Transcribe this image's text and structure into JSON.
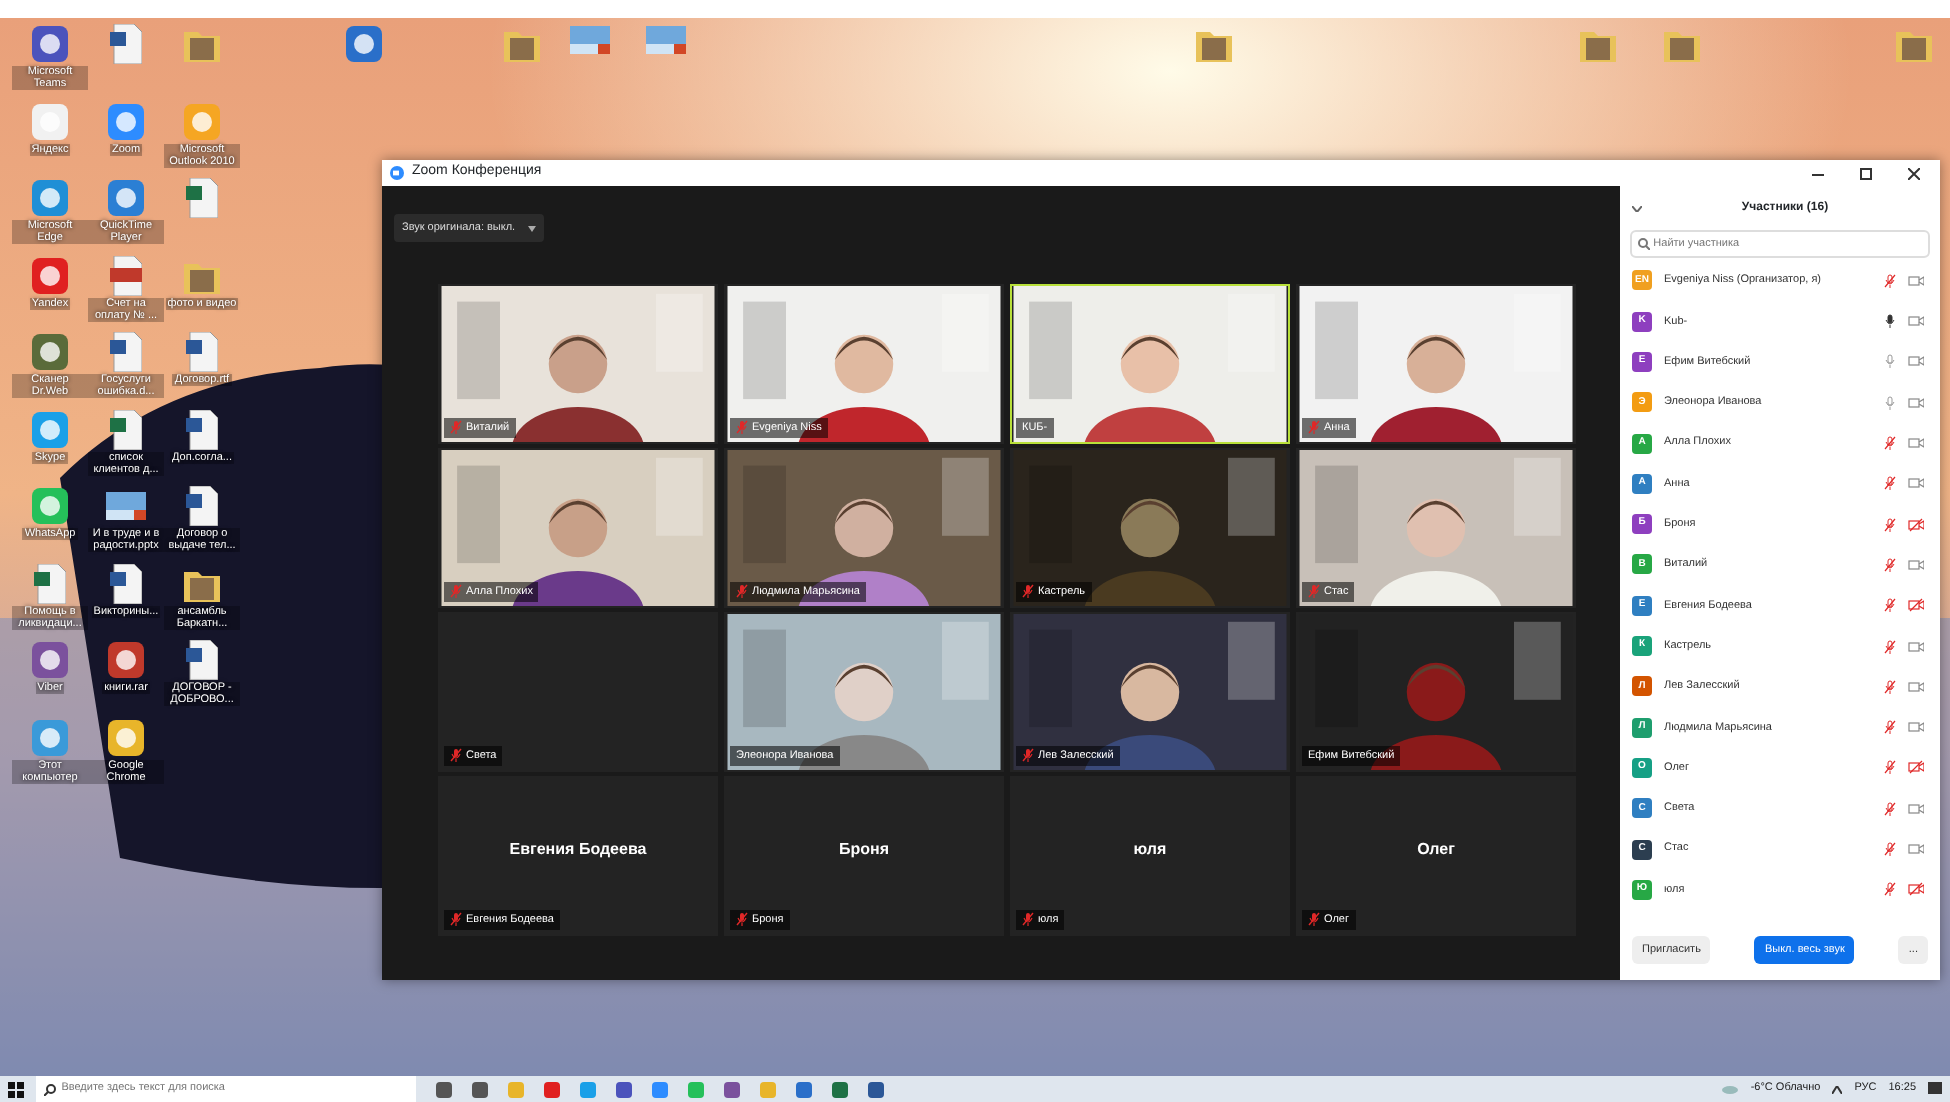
{
  "desktop_icons": [
    {
      "kind": "app",
      "color": "#4b53bc",
      "label": "Microsoft Teams"
    },
    {
      "kind": "doc"
    },
    {
      "kind": "folder"
    },
    {
      "kind": "app",
      "color": "#f1f1f1",
      "label": "Яндекс"
    },
    {
      "kind": "app",
      "color": "#2d8cff",
      "label": "Zoom"
    },
    {
      "kind": "app",
      "color": "#f5a623",
      "label": "Microsoft Outlook 2010"
    },
    {
      "kind": "app",
      "color": "#1f8fd6",
      "label": "Microsoft Edge"
    },
    {
      "kind": "app",
      "color": "#2b7fd4",
      "label": "QuickTime Player"
    },
    {
      "kind": "sheet"
    },
    {
      "kind": "app",
      "color": "#e02020",
      "label": "Yandex"
    },
    {
      "kind": "pdf",
      "label": "Счет на оплату № ..."
    },
    {
      "kind": "folder",
      "label": "фото и видео"
    },
    {
      "kind": "app",
      "color": "#5a6b3a",
      "label": "Сканер Dr.Web"
    },
    {
      "kind": "doc",
      "label": "Госуслуги ошибка.d..."
    },
    {
      "kind": "doc",
      "label": "Договор.rtf"
    },
    {
      "kind": "app",
      "color": "#1aa0e8",
      "label": "Skype"
    },
    {
      "kind": "sheet",
      "label": "список клиентов д..."
    },
    {
      "kind": "doc",
      "label": "Доп.согла..."
    },
    {
      "kind": "app",
      "color": "#25c05a",
      "label": "WhatsApp"
    },
    {
      "kind": "slide",
      "label": "И в труде и в радости.pptx"
    },
    {
      "kind": "doc",
      "label": "Договор о выдаче тел..."
    },
    {
      "kind": "sheet",
      "label": "Помощь в ликвидаци..."
    },
    {
      "kind": "doc",
      "label": "Викторины..."
    },
    {
      "kind": "folder",
      "label": "ансамбль Баркатн..."
    },
    {
      "kind": "app",
      "color": "#7b519d",
      "label": "Viber"
    },
    {
      "kind": "app",
      "color": "#c0392b",
      "label": "книги.rar"
    },
    {
      "kind": "doc",
      "label": "ДОГОВОР - ДОБРОВО..."
    },
    {
      "kind": "app",
      "color": "#3a9ad9",
      "label": "Этот компьютер"
    },
    {
      "kind": "app",
      "color": "#e8b52a",
      "label": "Google Chrome"
    }
  ],
  "window": {
    "title": "Zoom Конференция",
    "audio_dropdown": "Звук оригинала: выкл."
  },
  "tiles": [
    {
      "kind": "video",
      "name": "Виталий",
      "muted": true,
      "speaking": false
    },
    {
      "kind": "video",
      "name": "Evgeniya Niss",
      "muted": true,
      "speaking": false
    },
    {
      "kind": "video",
      "name": "КUБ-",
      "muted": false,
      "speaking": true
    },
    {
      "kind": "video",
      "name": "Анна",
      "muted": true,
      "speaking": false
    },
    {
      "kind": "video",
      "name": "Алла Плохих",
      "muted": true,
      "speaking": false
    },
    {
      "kind": "video",
      "name": "Людмила Марьясина",
      "muted": true,
      "speaking": false
    },
    {
      "kind": "video",
      "name": "Кастрель",
      "muted": true,
      "speaking": false
    },
    {
      "kind": "video",
      "name": "Стас",
      "muted": true,
      "speaking": false
    },
    {
      "kind": "blank",
      "name": "Света",
      "muted": true,
      "speaking": false
    },
    {
      "kind": "video",
      "name": "Элеонора Иванова",
      "muted": false,
      "speaking": false
    },
    {
      "kind": "video",
      "name": "Лев Залесский",
      "muted": true,
      "speaking": false
    },
    {
      "kind": "video",
      "name": "Ефим Витебский",
      "muted": false,
      "speaking": false
    },
    {
      "kind": "avatar",
      "display": "Евгения Бодеева",
      "name": "Евгения Бодеева",
      "muted": true,
      "speaking": false
    },
    {
      "kind": "avatar",
      "display": "Броня",
      "name": "Броня",
      "muted": true,
      "speaking": false
    },
    {
      "kind": "avatar",
      "display": "юля",
      "name": "юля",
      "muted": true,
      "speaking": false
    },
    {
      "kind": "avatar",
      "display": "Олег",
      "name": "Олег",
      "muted": true,
      "speaking": false
    }
  ],
  "participants_panel": {
    "title": "Участники (16)",
    "search": {
      "placeholder": "Найти участника"
    },
    "participants": [
      {
        "initial": "EN",
        "color": "#f0a020",
        "name": "Evgeniya Niss (Организатор, я)",
        "muted": true,
        "talking": false,
        "video_off": false
      },
      {
        "initial": "K",
        "color": "#8e3fbf",
        "name": "Kub-",
        "muted": false,
        "talking": true,
        "video_off": false
      },
      {
        "initial": "Е",
        "color": "#8e3fbf",
        "name": "Ефим Витебский",
        "muted": false,
        "talking": false,
        "video_off": false
      },
      {
        "initial": "Э",
        "color": "#f39c12",
        "name": "Элеонора Иванова",
        "muted": false,
        "talking": false,
        "video_off": false
      },
      {
        "initial": "А",
        "color": "#27a845",
        "name": "Алла Плохих",
        "muted": true,
        "talking": false,
        "video_off": false
      },
      {
        "initial": "А",
        "color": "#2f7fc1",
        "name": "Анна",
        "muted": true,
        "talking": false,
        "video_off": false
      },
      {
        "initial": "Б",
        "color": "#8e3fbf",
        "name": "Броня",
        "muted": true,
        "talking": false,
        "video_off": true
      },
      {
        "initial": "В",
        "color": "#27a845",
        "name": "Виталий",
        "muted": true,
        "talking": false,
        "video_off": false
      },
      {
        "initial": "Е",
        "color": "#2f7fc1",
        "name": "Евгения Бодеева",
        "muted": true,
        "talking": false,
        "video_off": true
      },
      {
        "initial": "К",
        "color": "#1aa37a",
        "name": "Кастрель",
        "muted": true,
        "talking": false,
        "video_off": false
      },
      {
        "initial": "Л",
        "color": "#d35400",
        "name": "Лев Залесский",
        "muted": true,
        "talking": false,
        "video_off": false
      },
      {
        "initial": "Л",
        "color": "#1e9e6e",
        "name": "Людмила Марьясина",
        "muted": true,
        "talking": false,
        "video_off": false
      },
      {
        "initial": "О",
        "color": "#16a085",
        "name": "Олег",
        "muted": true,
        "talking": false,
        "video_off": true
      },
      {
        "initial": "С",
        "color": "#2f7fc1",
        "name": "Света",
        "muted": true,
        "talking": false,
        "video_off": false
      },
      {
        "initial": "С",
        "color": "#2c3e50",
        "name": "Стас",
        "muted": true,
        "talking": false,
        "video_off": false
      },
      {
        "initial": "Ю",
        "color": "#27a845",
        "name": "юля",
        "muted": true,
        "talking": false,
        "video_off": true
      }
    ],
    "buttons": [
      {
        "kind": "plain",
        "label": "Пригласить"
      },
      {
        "kind": "primary",
        "label": "Выкл. весь звук"
      },
      {
        "kind": "more",
        "label": "..."
      }
    ]
  },
  "taskbar": {
    "search_placeholder": "Введите здесь текст для поиска",
    "weather": "-6°C Облачно",
    "language": "РУС",
    "time": "16:25"
  }
}
